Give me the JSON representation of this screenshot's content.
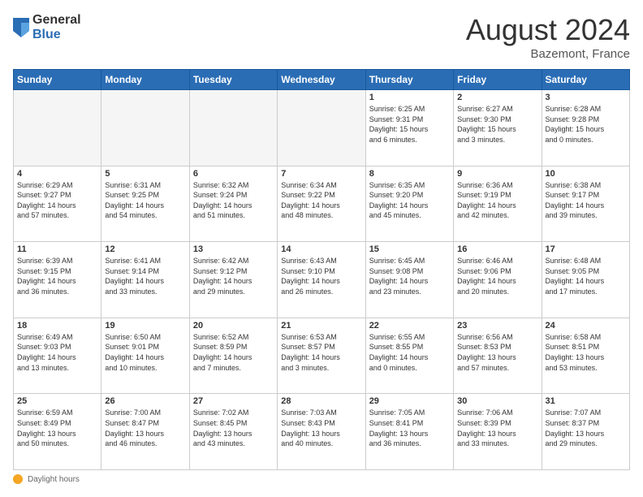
{
  "logo": {
    "general": "General",
    "blue": "Blue"
  },
  "title": "August 2024",
  "location": "Bazemont, France",
  "days_of_week": [
    "Sunday",
    "Monday",
    "Tuesday",
    "Wednesday",
    "Thursday",
    "Friday",
    "Saturday"
  ],
  "footer": {
    "label": "Daylight hours"
  },
  "weeks": [
    [
      {
        "day": "",
        "info": ""
      },
      {
        "day": "",
        "info": ""
      },
      {
        "day": "",
        "info": ""
      },
      {
        "day": "",
        "info": ""
      },
      {
        "day": "1",
        "info": "Sunrise: 6:25 AM\nSunset: 9:31 PM\nDaylight: 15 hours\nand 6 minutes."
      },
      {
        "day": "2",
        "info": "Sunrise: 6:27 AM\nSunset: 9:30 PM\nDaylight: 15 hours\nand 3 minutes."
      },
      {
        "day": "3",
        "info": "Sunrise: 6:28 AM\nSunset: 9:28 PM\nDaylight: 15 hours\nand 0 minutes."
      }
    ],
    [
      {
        "day": "4",
        "info": "Sunrise: 6:29 AM\nSunset: 9:27 PM\nDaylight: 14 hours\nand 57 minutes."
      },
      {
        "day": "5",
        "info": "Sunrise: 6:31 AM\nSunset: 9:25 PM\nDaylight: 14 hours\nand 54 minutes."
      },
      {
        "day": "6",
        "info": "Sunrise: 6:32 AM\nSunset: 9:24 PM\nDaylight: 14 hours\nand 51 minutes."
      },
      {
        "day": "7",
        "info": "Sunrise: 6:34 AM\nSunset: 9:22 PM\nDaylight: 14 hours\nand 48 minutes."
      },
      {
        "day": "8",
        "info": "Sunrise: 6:35 AM\nSunset: 9:20 PM\nDaylight: 14 hours\nand 45 minutes."
      },
      {
        "day": "9",
        "info": "Sunrise: 6:36 AM\nSunset: 9:19 PM\nDaylight: 14 hours\nand 42 minutes."
      },
      {
        "day": "10",
        "info": "Sunrise: 6:38 AM\nSunset: 9:17 PM\nDaylight: 14 hours\nand 39 minutes."
      }
    ],
    [
      {
        "day": "11",
        "info": "Sunrise: 6:39 AM\nSunset: 9:15 PM\nDaylight: 14 hours\nand 36 minutes."
      },
      {
        "day": "12",
        "info": "Sunrise: 6:41 AM\nSunset: 9:14 PM\nDaylight: 14 hours\nand 33 minutes."
      },
      {
        "day": "13",
        "info": "Sunrise: 6:42 AM\nSunset: 9:12 PM\nDaylight: 14 hours\nand 29 minutes."
      },
      {
        "day": "14",
        "info": "Sunrise: 6:43 AM\nSunset: 9:10 PM\nDaylight: 14 hours\nand 26 minutes."
      },
      {
        "day": "15",
        "info": "Sunrise: 6:45 AM\nSunset: 9:08 PM\nDaylight: 14 hours\nand 23 minutes."
      },
      {
        "day": "16",
        "info": "Sunrise: 6:46 AM\nSunset: 9:06 PM\nDaylight: 14 hours\nand 20 minutes."
      },
      {
        "day": "17",
        "info": "Sunrise: 6:48 AM\nSunset: 9:05 PM\nDaylight: 14 hours\nand 17 minutes."
      }
    ],
    [
      {
        "day": "18",
        "info": "Sunrise: 6:49 AM\nSunset: 9:03 PM\nDaylight: 14 hours\nand 13 minutes."
      },
      {
        "day": "19",
        "info": "Sunrise: 6:50 AM\nSunset: 9:01 PM\nDaylight: 14 hours\nand 10 minutes."
      },
      {
        "day": "20",
        "info": "Sunrise: 6:52 AM\nSunset: 8:59 PM\nDaylight: 14 hours\nand 7 minutes."
      },
      {
        "day": "21",
        "info": "Sunrise: 6:53 AM\nSunset: 8:57 PM\nDaylight: 14 hours\nand 3 minutes."
      },
      {
        "day": "22",
        "info": "Sunrise: 6:55 AM\nSunset: 8:55 PM\nDaylight: 14 hours\nand 0 minutes."
      },
      {
        "day": "23",
        "info": "Sunrise: 6:56 AM\nSunset: 8:53 PM\nDaylight: 13 hours\nand 57 minutes."
      },
      {
        "day": "24",
        "info": "Sunrise: 6:58 AM\nSunset: 8:51 PM\nDaylight: 13 hours\nand 53 minutes."
      }
    ],
    [
      {
        "day": "25",
        "info": "Sunrise: 6:59 AM\nSunset: 8:49 PM\nDaylight: 13 hours\nand 50 minutes."
      },
      {
        "day": "26",
        "info": "Sunrise: 7:00 AM\nSunset: 8:47 PM\nDaylight: 13 hours\nand 46 minutes."
      },
      {
        "day": "27",
        "info": "Sunrise: 7:02 AM\nSunset: 8:45 PM\nDaylight: 13 hours\nand 43 minutes."
      },
      {
        "day": "28",
        "info": "Sunrise: 7:03 AM\nSunset: 8:43 PM\nDaylight: 13 hours\nand 40 minutes."
      },
      {
        "day": "29",
        "info": "Sunrise: 7:05 AM\nSunset: 8:41 PM\nDaylight: 13 hours\nand 36 minutes."
      },
      {
        "day": "30",
        "info": "Sunrise: 7:06 AM\nSunset: 8:39 PM\nDaylight: 13 hours\nand 33 minutes."
      },
      {
        "day": "31",
        "info": "Sunrise: 7:07 AM\nSunset: 8:37 PM\nDaylight: 13 hours\nand 29 minutes."
      }
    ]
  ]
}
